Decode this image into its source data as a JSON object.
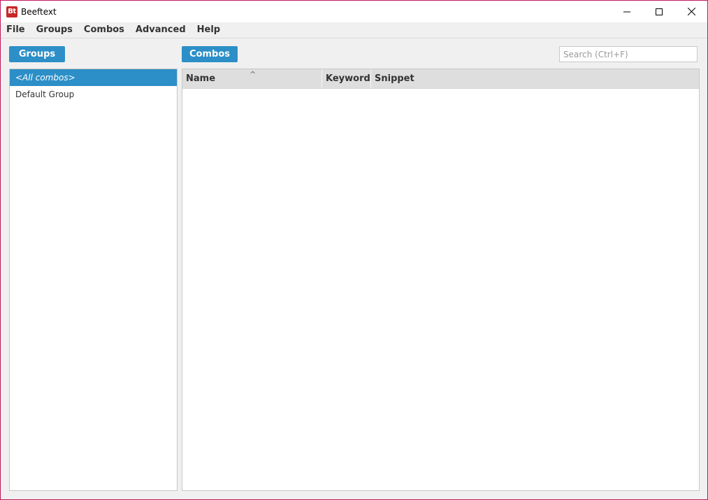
{
  "window": {
    "title": "Beeftext",
    "icon_text": "Bt"
  },
  "window_controls": [
    "minimize-icon",
    "maximize-icon",
    "close-icon"
  ],
  "menu": [
    {
      "label": "File"
    },
    {
      "label": "Groups"
    },
    {
      "label": "Combos"
    },
    {
      "label": "Advanced"
    },
    {
      "label": "Help"
    }
  ],
  "groups_button": {
    "label": "Groups"
  },
  "combos_button": {
    "label": "Combos"
  },
  "search": {
    "placeholder": "Search (Ctrl+F)",
    "value": ""
  },
  "groups": [
    {
      "label": "<All combos>",
      "selected": true
    },
    {
      "label": "Default Group",
      "selected": false
    }
  ],
  "table": {
    "columns": [
      {
        "label": "Name",
        "sorted": true,
        "sort_arrow": "^"
      },
      {
        "label": "Keyword"
      },
      {
        "label": "Snippet"
      }
    ],
    "rows": []
  },
  "colors": {
    "accent": "#2c8fc7",
    "window_border": "#c2185b",
    "app_icon": "#c62828"
  }
}
